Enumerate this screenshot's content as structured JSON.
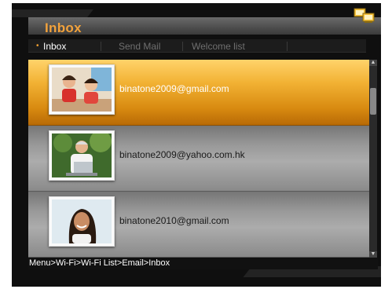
{
  "header": {
    "title": "Inbox"
  },
  "tabs": [
    {
      "label": "Inbox",
      "active": true
    },
    {
      "label": "Send Mail",
      "active": false
    },
    {
      "label": "Welcome list",
      "active": false
    }
  ],
  "messages": [
    {
      "email": "binatone2009@gmail.com",
      "thumbnail": "two-children-photo",
      "selected": true
    },
    {
      "email": "binatone2009@yahoo.com.hk",
      "thumbnail": "man-with-laptop-photo",
      "selected": false
    },
    {
      "email": "binatone2010@gmail.com",
      "thumbnail": "smiling-woman-photo",
      "selected": false
    }
  ],
  "breadcrumb": "Menu>Wi-Fi>Wi-Fi List>Email>Inbox",
  "icons": {
    "status": "network-computers-icon"
  },
  "colors": {
    "title": "#f2a23c",
    "selected_row": "#f2b234",
    "accent_bullet": "#f0a030"
  }
}
